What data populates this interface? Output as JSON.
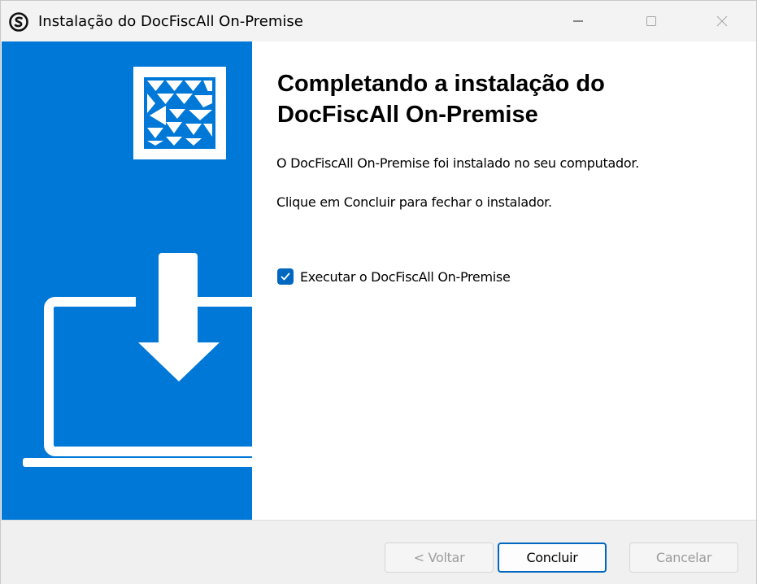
{
  "window": {
    "title": "Instalação do DocFiscAll On-Premise",
    "controls": {
      "minimize_icon": "minimize-icon",
      "maximize_icon": "maximize-icon",
      "close_icon": "close-icon"
    }
  },
  "colors": {
    "accent_blue": "#0078d7",
    "checkbox_blue": "#0067c0",
    "footer_bg": "#f0f0f0",
    "disabled_text": "#9d9d9d"
  },
  "main": {
    "heading": "Completando a instalação do DocFiscAll On-Premise",
    "message_installed": "O DocFiscAll On-Premise foi instalado no seu computador.",
    "message_close": "Clique em Concluir para fechar o instalador.",
    "run_checkbox": {
      "label": "Executar o DocFiscAll On-Premise",
      "checked": true
    }
  },
  "footer": {
    "back_label": "< Voltar",
    "finish_label": "Concluir",
    "cancel_label": "Cancelar",
    "back_enabled": false,
    "cancel_enabled": false
  }
}
